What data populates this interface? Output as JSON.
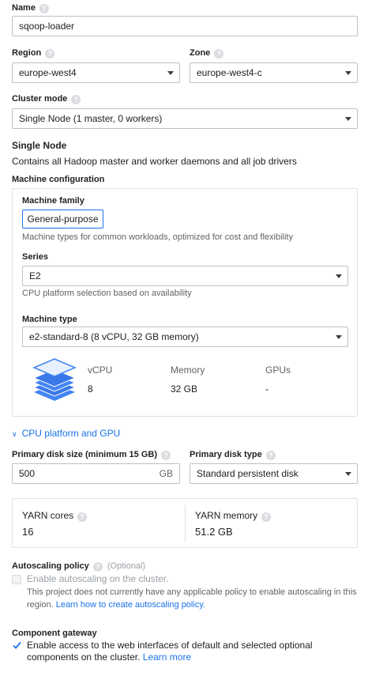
{
  "name": {
    "label": "Name",
    "value": "sqoop-loader"
  },
  "region": {
    "label": "Region",
    "value": "europe-west4"
  },
  "zone": {
    "label": "Zone",
    "value": "europe-west4-c"
  },
  "cluster_mode": {
    "label": "Cluster mode",
    "value": "Single Node (1 master, 0 workers)"
  },
  "single_node": {
    "title": "Single Node",
    "description": "Contains all Hadoop master and worker daemons and all job drivers"
  },
  "machine_config": {
    "title": "Machine configuration",
    "family_label": "Machine family",
    "family_tab": "General-purpose",
    "family_hint": "Machine types for common workloads, optimized for cost and flexibility",
    "series_label": "Series",
    "series_value": "E2",
    "series_hint": "CPU platform selection based on availability",
    "type_label": "Machine type",
    "type_value": "e2-standard-8 (8 vCPU, 32 GB memory)",
    "stats": {
      "vcpu_label": "vCPU",
      "vcpu_value": "8",
      "memory_label": "Memory",
      "memory_value": "32 GB",
      "gpus_label": "GPUs",
      "gpus_value": "-"
    }
  },
  "cpu_platform_link": "CPU platform and GPU",
  "disk_size": {
    "label": "Primary disk size (minimum 15 GB)",
    "value": "500",
    "unit": "GB"
  },
  "disk_type": {
    "label": "Primary disk type",
    "value": "Standard persistent disk"
  },
  "yarn": {
    "cores_label": "YARN cores",
    "cores_value": "16",
    "memory_label": "YARN memory",
    "memory_value": "51.2 GB"
  },
  "autoscaling": {
    "title": "Autoscaling policy",
    "optional": "(Optional)",
    "checkbox_label": "Enable autoscaling on the cluster.",
    "note": "This project does not currently have any applicable policy to enable autoscaling in this region.",
    "link": "Learn how to create autoscaling policy."
  },
  "gateway": {
    "title": "Component gateway",
    "checkbox_text": "Enable access to the web interfaces of default and selected optional components on the cluster.",
    "link": "Learn more"
  },
  "colors": {
    "accent": "#1a73e8",
    "border": "#bdc1c6",
    "stack_icon": "#4285f4"
  }
}
